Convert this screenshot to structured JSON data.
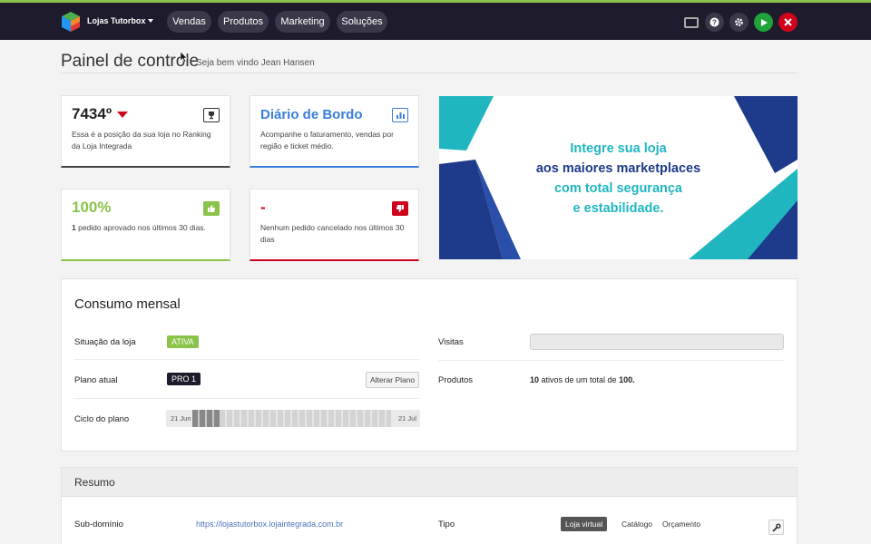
{
  "topbar": {
    "store_name": "Lojas Tutorbox",
    "nav": [
      "Vendas",
      "Produtos",
      "Marketing",
      "Soluções"
    ],
    "icons": [
      "monitor-icon",
      "help-icon",
      "gear-icon",
      "play-icon",
      "close-icon"
    ],
    "accent": "#8bc34a"
  },
  "header": {
    "title": "Painel de controle",
    "subtitle": "Seja bem vindo Jean Hansen"
  },
  "cards": {
    "ranking": {
      "value": "7434º",
      "text": "Essa é a posição da sua loja no Ranking da Loja Integrada",
      "color": "#444444"
    },
    "diario": {
      "value": "Diário de Bordo",
      "text": "Acompanhe o faturamento, vendas por região e ticket médio.",
      "color": "#3b7ddd"
    },
    "aprovados": {
      "value": "100%",
      "count": "1",
      "text": " pedido aprovado nos últimos 30 dias.",
      "color": "#8bc34a"
    },
    "cancelados": {
      "value": "-",
      "text": "Nenhum pedido cancelado nos últimos 30 dias",
      "color": "#d0021b"
    }
  },
  "banner": {
    "line1": "Integre sua loja",
    "line2a": "aos ",
    "line2b": "maiores marketplaces",
    "line3": "com total segurança",
    "line4": "e estabilidade."
  },
  "consumo": {
    "title": "Consumo mensal",
    "situacao_label": "Situação da loja",
    "situacao_value": "ATIVA",
    "plano_label": "Plano atual",
    "plano_value": "PRO 1",
    "alterar_plano": "Alterar Plano",
    "ciclo_label": "Ciclo do plano",
    "ciclo_start": "21 Jun",
    "ciclo_end": "21 Jul",
    "ciclo_progress_pct": 11,
    "visitas_label": "Visitas",
    "produtos_label": "Produtos",
    "produtos_count": "10",
    "produtos_middle": " ativos de um total de ",
    "produtos_total": "100."
  },
  "resumo": {
    "title": "Resumo",
    "subdominio_label": "Sub-domínio",
    "subdominio_value": "https://lojastutorbox.lojaintegrada.com.br",
    "tipo_label": "Tipo",
    "tipo_options": [
      "Loja virtual",
      "Catálogo",
      "Orçamento"
    ],
    "tipo_selected": "Loja virtual"
  }
}
